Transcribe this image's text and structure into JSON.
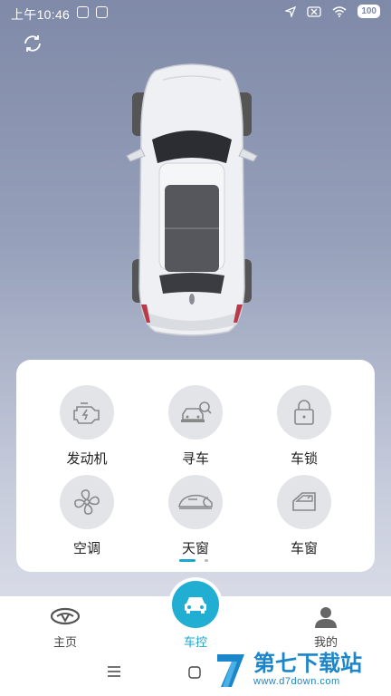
{
  "status_bar": {
    "time": "上午10:46",
    "battery": "100"
  },
  "controls": [
    {
      "label": "发动机",
      "icon": "engine-icon"
    },
    {
      "label": "寻车",
      "icon": "find-car-icon"
    },
    {
      "label": "车锁",
      "icon": "lock-icon"
    },
    {
      "label": "空调",
      "icon": "fan-icon"
    },
    {
      "label": "天窗",
      "icon": "sunroof-icon"
    },
    {
      "label": "车窗",
      "icon": "window-icon"
    }
  ],
  "nav": {
    "home": "主页",
    "control": "车控",
    "me": "我的"
  },
  "colors": {
    "accent": "#20aed2",
    "accent_text": "#1ba7d1"
  },
  "watermark": {
    "title": "第七下载站",
    "url": "www.d7down.com"
  }
}
